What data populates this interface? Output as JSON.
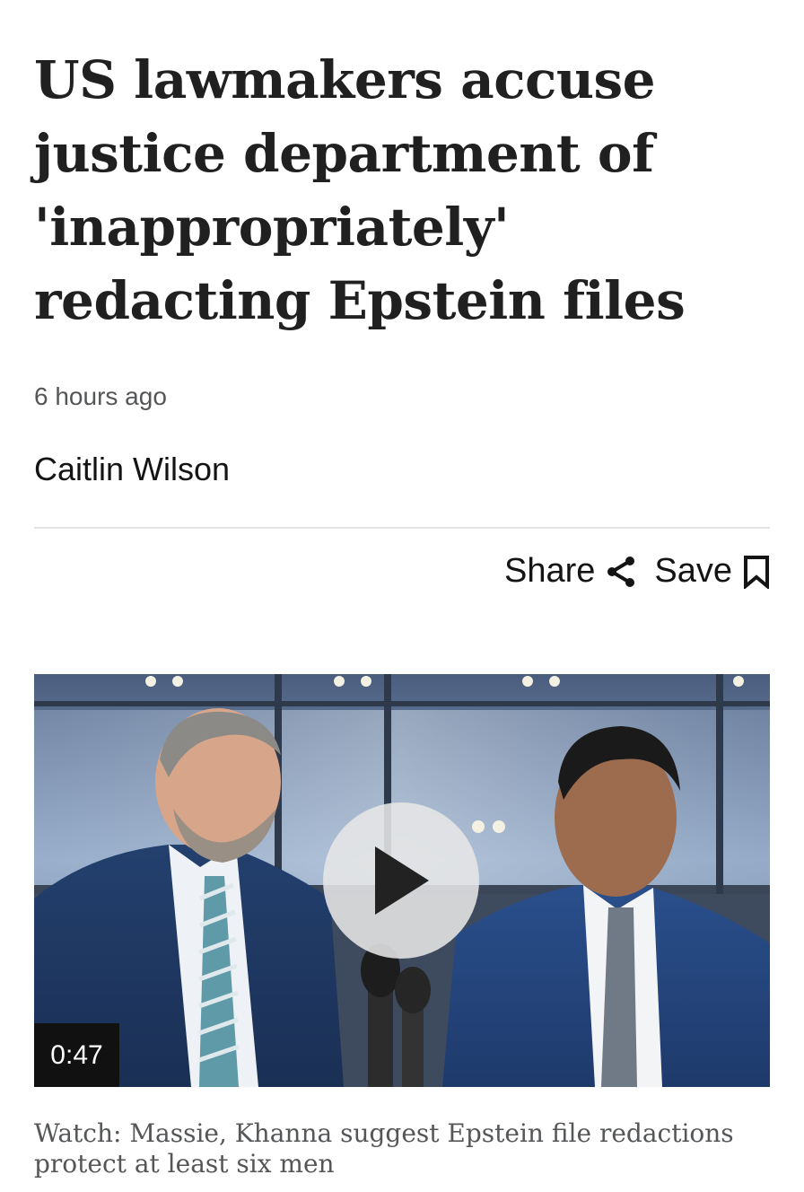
{
  "article": {
    "headline": "US lawmakers accuse justice department of 'inappropriately' redacting Epstein files",
    "timestamp": "6 hours ago",
    "author": "Caitlin Wilson"
  },
  "actions": {
    "share_label": "Share",
    "share_icon": "share-icon",
    "save_label": "Save",
    "save_icon": "bookmark-icon"
  },
  "video": {
    "duration": "0:47",
    "play_icon": "play-icon",
    "caption": "Watch: Massie, Khanna suggest Epstein file redactions protect at least six men"
  }
}
